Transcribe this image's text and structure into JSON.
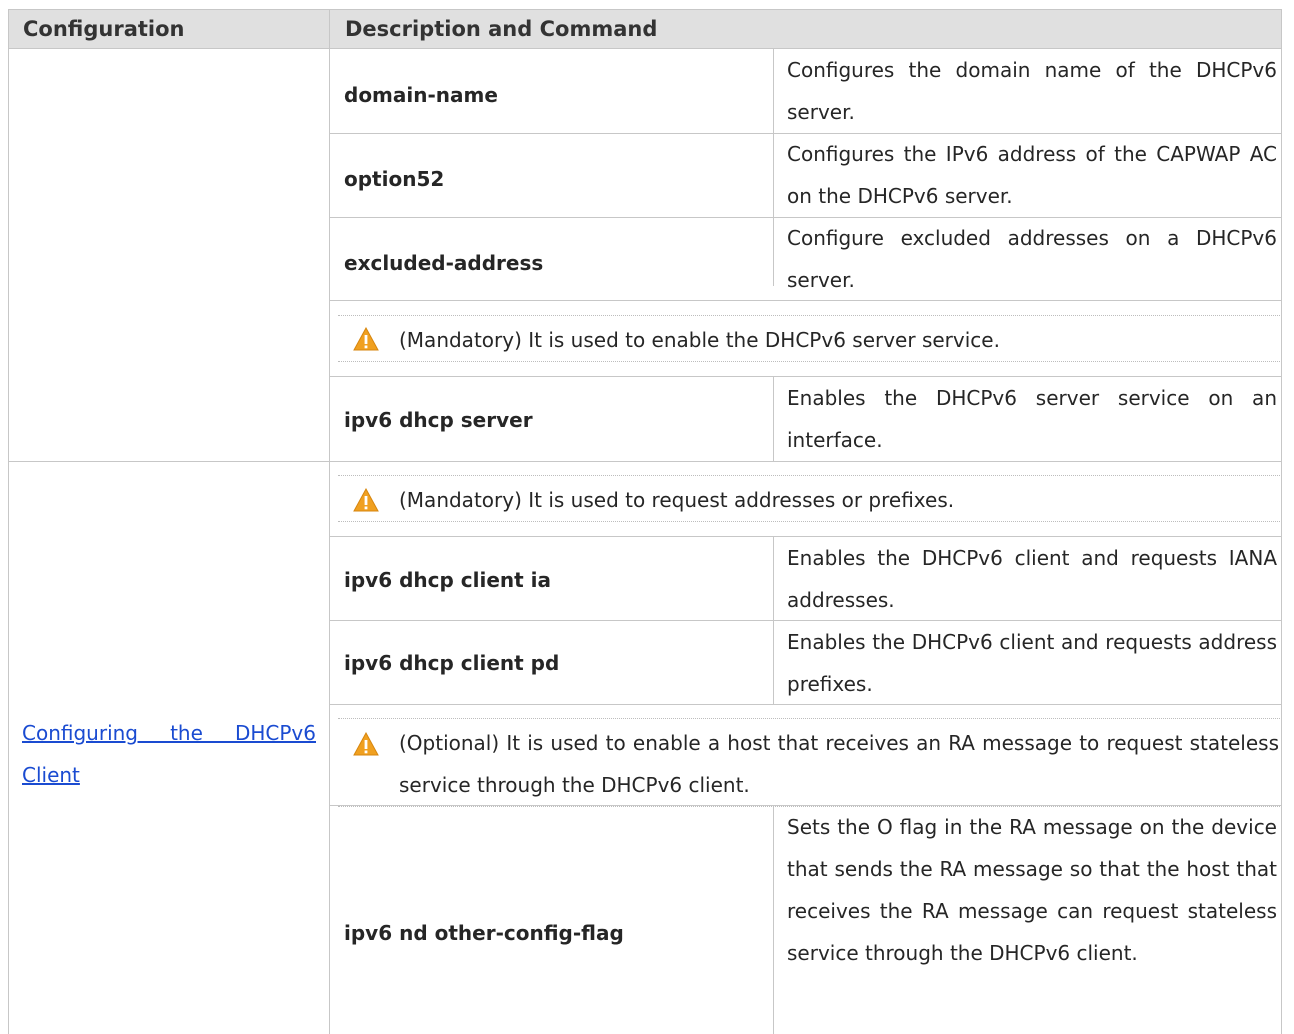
{
  "table": {
    "headers": [
      "Configuration",
      "Description and Command"
    ],
    "server_rows": [
      {
        "command": "domain-name",
        "description": "Configures the domain name of the DHCPv6 server."
      },
      {
        "command": "option52",
        "description": "Configures the IPv6 address of the CAPWAP AC on the DHCPv6 server."
      },
      {
        "command": "excluded-address",
        "description": "Configure excluded addresses on a DHCPv6 server."
      }
    ],
    "server_note": "(Mandatory) It is used to enable the DHCPv6 server service.",
    "server_enable": {
      "command": "ipv6 dhcp server",
      "description": "Enables the DHCPv6 server service on an interface."
    },
    "client_section": {
      "configuration_link": "Configuring the DHCPv6 Client",
      "link_line1": "Configuring the DHCPv6",
      "link_line2": "Client",
      "note_mandatory": "(Mandatory) It is used to request addresses or prefixes.",
      "rows": [
        {
          "command": "ipv6 dhcp client ia",
          "description": "Enables the DHCPv6 client and requests IANA addresses."
        },
        {
          "command": "ipv6 dhcp client pd",
          "description": "Enables the DHCPv6 client and requests address prefixes."
        }
      ],
      "note_optional": "(Optional) It is used to enable a host that receives an RA message to request stateless service through the DHCPv6 client.",
      "other_config": {
        "command": "ipv6 nd other-config-flag",
        "description": "Sets the O flag in the RA message on the device that sends the RA message so that the host that receives the RA message can request stateless service through the DHCPv6 client."
      }
    }
  },
  "icons": {
    "warning": "warning-triangle-icon"
  },
  "colors": {
    "header_bg": "#e0e0e0",
    "link": "#1a4bd1",
    "warning": "#f0a020"
  }
}
